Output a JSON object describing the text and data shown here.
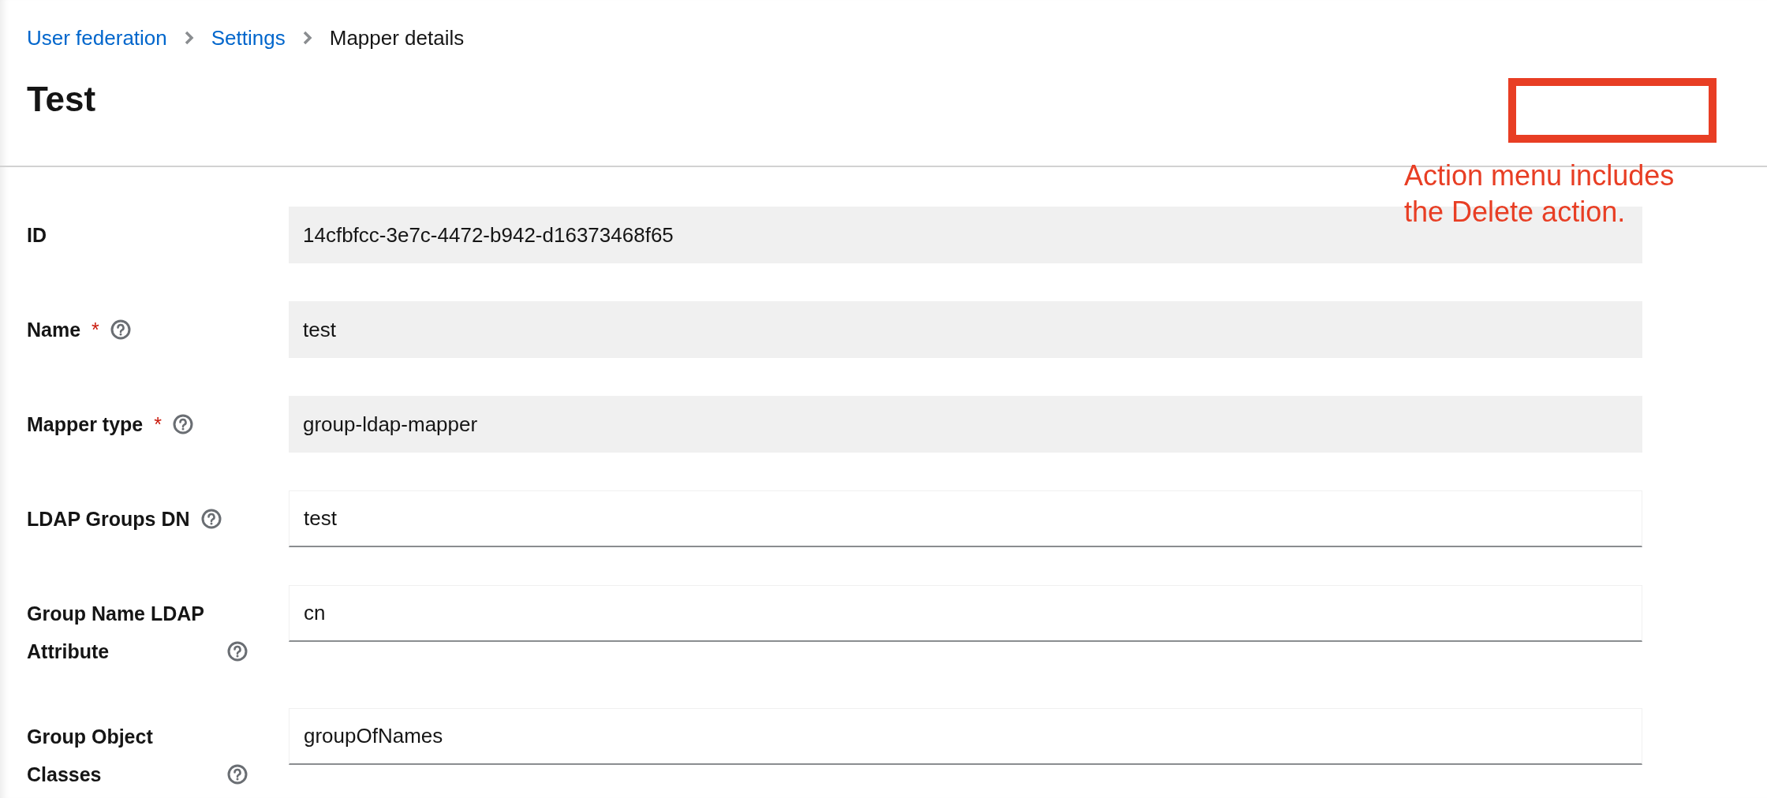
{
  "breadcrumbs": [
    {
      "label": "User federation",
      "kind": "link"
    },
    {
      "label": "Settings",
      "kind": "link"
    },
    {
      "label": "Mapper details",
      "kind": "current"
    }
  ],
  "title": "Test",
  "annotation": {
    "text": "Action menu includes the Delete action."
  },
  "fields": [
    {
      "label": "ID",
      "help": false,
      "value": "14cfbfcc-3e7c-4472-b942-d16373468f65",
      "readonly": true
    },
    {
      "label": "Name",
      "required_mark": "*",
      "help": true,
      "value": "test",
      "readonly": true
    },
    {
      "label": "Mapper type",
      "required_mark": "*",
      "help": true,
      "value": "group-ldap-mapper",
      "readonly": true
    },
    {
      "label": "LDAP Groups DN",
      "help": true,
      "value": "test",
      "readonly": false
    },
    {
      "label": "Group Name LDAP Attribute",
      "help": true,
      "value": "cn",
      "readonly": false
    },
    {
      "label": "Group Object Classes",
      "help": true,
      "value": "groupOfNames",
      "readonly": false
    }
  ]
}
